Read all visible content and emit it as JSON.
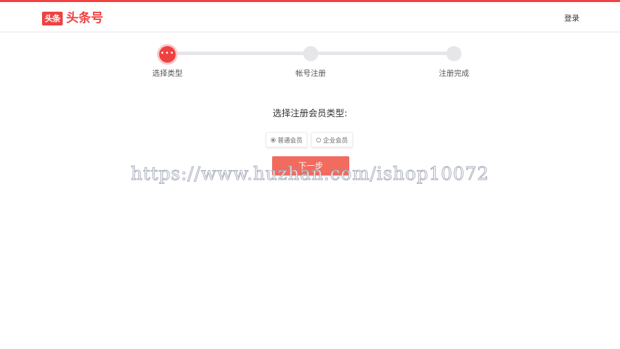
{
  "colors": {
    "brand": "#f04142",
    "button": "#f26b5f",
    "track": "#e6e6ea"
  },
  "header": {
    "logo_badge": "头条",
    "logo_text": "头条号",
    "login_label": "登录"
  },
  "steps": {
    "current": 1,
    "items": [
      {
        "label": "选择类型",
        "active": true
      },
      {
        "label": "帐号注册",
        "active": false
      },
      {
        "label": "注册完成",
        "active": false
      }
    ],
    "active_marker": "•••"
  },
  "form": {
    "prompt": "选择注册会员类型:",
    "options": [
      {
        "label": "普通会员",
        "selected": true
      },
      {
        "label": "企业会员",
        "selected": false
      }
    ],
    "next_label": "下一步"
  },
  "watermark": {
    "text": "https://www.huzhan.com/ishop10072"
  }
}
